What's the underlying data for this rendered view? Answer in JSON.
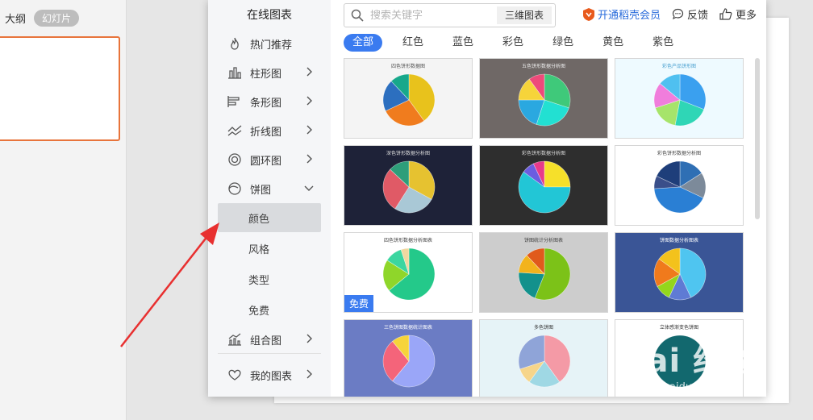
{
  "left_pane": {
    "tab_outline": "大纲",
    "tab_slides": "幻灯片"
  },
  "sidebar": {
    "title": "在线图表",
    "items": [
      {
        "label": "热门推荐",
        "icon": "flame-icon",
        "chevron": false
      },
      {
        "label": "柱形图",
        "icon": "bar-chart-icon",
        "chevron": true
      },
      {
        "label": "条形图",
        "icon": "horizontal-bar-icon",
        "chevron": true
      },
      {
        "label": "折线图",
        "icon": "line-chart-icon",
        "chevron": true
      },
      {
        "label": "圆环图",
        "icon": "donut-chart-icon",
        "chevron": true
      },
      {
        "label": "饼图",
        "icon": "pie-chart-icon",
        "chevron": true,
        "expanded": true
      },
      {
        "label": "组合图",
        "icon": "combo-chart-icon",
        "chevron": true
      },
      {
        "label": "我的图表",
        "icon": "heart-icon",
        "chevron": true
      }
    ],
    "pie_sub": [
      "颜色",
      "风格",
      "类型",
      "免费"
    ],
    "pie_sub_active": "颜色"
  },
  "search": {
    "placeholder": "搜索关键字",
    "tag": "三维图表"
  },
  "actions": {
    "vip": "开通稻壳会员",
    "feedback": "反馈",
    "more": "更多"
  },
  "filters": [
    "全部",
    "红色",
    "蓝色",
    "彩色",
    "绿色",
    "黄色",
    "紫色"
  ],
  "filter_active": "全部",
  "cards": [
    {
      "title": "四色饼形数据图",
      "bg": "#f4f4f4",
      "title_color": "#555",
      "slices": [
        {
          "v": 40,
          "c": "#e8c21c"
        },
        {
          "v": 28,
          "c": "#f07c1e"
        },
        {
          "v": 20,
          "c": "#2c6fbf"
        },
        {
          "v": 12,
          "c": "#17a88b"
        }
      ]
    },
    {
      "title": "五色饼形数据分析图",
      "bg": "#6f6866",
      "title_color": "#eee",
      "slices": [
        {
          "v": 30,
          "c": "#3fc97a"
        },
        {
          "v": 25,
          "c": "#22e0d2"
        },
        {
          "v": 20,
          "c": "#2aa8e0"
        },
        {
          "v": 15,
          "c": "#f6d43a"
        },
        {
          "v": 10,
          "c": "#ee4a7a"
        }
      ]
    },
    {
      "title": "彩色产品饼形图",
      "bg": "#eefaff",
      "title_color": "#4aa0d0",
      "slices": [
        {
          "v": 31,
          "c": "#3aa0ef"
        },
        {
          "v": 22,
          "c": "#2fd6b6"
        },
        {
          "v": 17,
          "c": "#a6e46a"
        },
        {
          "v": 16,
          "c": "#f07ddc"
        },
        {
          "v": 14,
          "c": "#4fc0f0"
        }
      ]
    },
    {
      "title": "深色饼形数据分析图",
      "bg": "#1e2238",
      "title_color": "#ddd",
      "slices": [
        {
          "v": 33,
          "c": "#e6c230"
        },
        {
          "v": 26,
          "c": "#a9c8d6"
        },
        {
          "v": 28,
          "c": "#e05a66"
        },
        {
          "v": 13,
          "c": "#2e9e7a"
        }
      ]
    },
    {
      "title": "彩色饼形数据分析图",
      "bg": "#2e2e2e",
      "title_color": "#ddd",
      "slices": [
        {
          "v": 25,
          "c": "#f6e02a"
        },
        {
          "v": 60,
          "c": "#22c6d6"
        },
        {
          "v": 8,
          "c": "#6b5de0"
        },
        {
          "v": 7,
          "c": "#e83a8a"
        }
      ]
    },
    {
      "title": "彩色饼形数据分析图",
      "bg": "#ffffff",
      "title_color": "#444",
      "slices": [
        {
          "v": 16,
          "c": "#2f6fb4"
        },
        {
          "v": 16,
          "c": "#7c8a9a"
        },
        {
          "v": 42,
          "c": "#2a7fd4"
        },
        {
          "v": 8,
          "c": "#3a4f8a"
        },
        {
          "v": 18,
          "c": "#1e3e7a"
        }
      ]
    },
    {
      "title": "四色饼形数据分析图表",
      "bg": "#ffffff",
      "title_color": "#444",
      "free": true,
      "slices": [
        {
          "v": 64,
          "c": "#24c98a"
        },
        {
          "v": 20,
          "c": "#8fd62a"
        },
        {
          "v": 11,
          "c": "#3bd6a0"
        },
        {
          "v": 5,
          "c": "#f0d8a0"
        }
      ]
    },
    {
      "title": "饼图统计分析图表",
      "bg": "#cdcdcd",
      "title_color": "#444",
      "slices": [
        {
          "v": 56,
          "c": "#7cc218"
        },
        {
          "v": 20,
          "c": "#13918c"
        },
        {
          "v": 12,
          "c": "#f2b31c"
        },
        {
          "v": 12,
          "c": "#e05a1c"
        }
      ]
    },
    {
      "title": "饼图数据分析图表",
      "bg": "#3a5596",
      "title_color": "#fff",
      "slices": [
        {
          "v": 43,
          "c": "#4fc5f0"
        },
        {
          "v": 14,
          "c": "#5f7bd4"
        },
        {
          "v": 10,
          "c": "#94d61c"
        },
        {
          "v": 18,
          "c": "#f07a1c"
        },
        {
          "v": 15,
          "c": "#f3c21c"
        }
      ]
    },
    {
      "title": "三色饼图数据统计图表",
      "bg": "#6b7cc4",
      "title_color": "#fff",
      "slices": [
        {
          "v": 61,
          "c": "#9aa6f8"
        },
        {
          "v": 28,
          "c": "#f4647a"
        },
        {
          "v": 11,
          "c": "#f6d43a"
        }
      ]
    },
    {
      "title": "多色饼图",
      "bg": "#e6f3f7",
      "title_color": "#333",
      "slices": [
        {
          "v": 40,
          "c": "#f49aa6"
        },
        {
          "v": 20,
          "c": "#9fd8e4"
        },
        {
          "v": 10,
          "c": "#f6d58a"
        },
        {
          "v": 30,
          "c": "#8fa4d8"
        }
      ]
    },
    {
      "title": "立体感渐变色饼图",
      "bg": "#ffffff",
      "title_color": "#333",
      "slices": [
        {
          "v": 100,
          "c": "#12686e"
        }
      ]
    }
  ],
  "watermark": {
    "logo": "Bai 经验",
    "url": "jingyan.baidu.com"
  },
  "colors": {
    "accent": "#3a7bf0",
    "vip": "#e85a1c",
    "slide_border": "#e8743b",
    "arrow": "#e83030"
  }
}
